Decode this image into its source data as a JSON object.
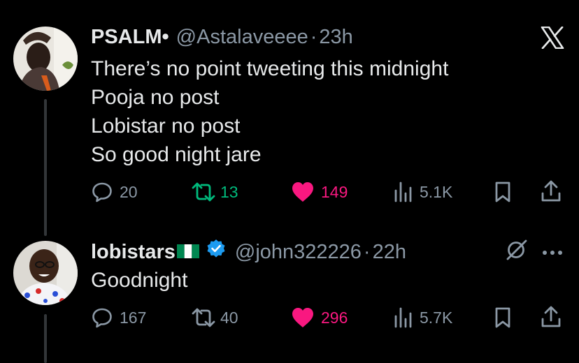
{
  "colors": {
    "background": "#000000",
    "text": "#e7e9ea",
    "muted": "#8b98a5",
    "retweet_active": "#00ba7c",
    "like_active": "#f91880",
    "verified": "#1d9bf0"
  },
  "tweets": [
    {
      "name": "PSALM•",
      "handle": "@Astalaveeee",
      "separator": "·",
      "time": "23h",
      "lines": [
        "There’s no point tweeting this midnight",
        "Pooja no post",
        "Lobistar no post",
        "So good night jare"
      ],
      "replies": "20",
      "retweets": "13",
      "likes": "149",
      "views": "5.1K",
      "retweeted": true,
      "liked": true
    },
    {
      "name": "lobistars",
      "flag": "nigeria-flag",
      "verified": true,
      "handle": "@john322226",
      "separator": "·",
      "time": "22h",
      "lines": [
        "Goodnight"
      ],
      "replies": "167",
      "retweets": "40",
      "likes": "296",
      "views": "5.7K",
      "retweeted": false,
      "liked": true
    }
  ],
  "icons": {
    "top_right_1": "x-logo-icon",
    "top_right_2": "grok-icon",
    "more": "more-icon"
  }
}
